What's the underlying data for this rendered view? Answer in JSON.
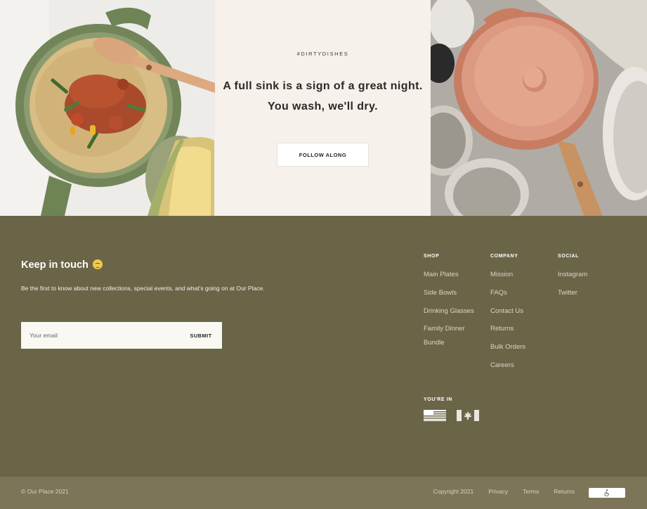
{
  "banner": {
    "hashtag": "#DIRTYDISHES",
    "headline_line1": "A full sink is a sign of a great night.",
    "headline_line2": "You wash, we'll dry.",
    "follow_label": "FOLLOW ALONG"
  },
  "newsletter": {
    "title": "Keep in touch",
    "subtitle": "Be the first to know about new collections, special events, and what's going on at Our Place.",
    "email_placeholder": "Your email",
    "submit_label": "SUBMIT"
  },
  "footer_nav": {
    "shop": {
      "heading": "SHOP",
      "links": [
        "Main Plates",
        "Side Bowls",
        "Drinking Glasses",
        "Family Dinner Bundle"
      ]
    },
    "company": {
      "heading": "COMPANY",
      "links": [
        "Mission",
        "FAQs",
        "Contact Us",
        "Returns",
        "Bulk Orders",
        "Careers"
      ]
    },
    "social": {
      "heading": "SOCIAL",
      "links": [
        "Instagram",
        "Twitter"
      ]
    }
  },
  "region": {
    "heading": "YOU'RE IN",
    "flags": [
      "us-flag-icon",
      "canada-flag-icon"
    ]
  },
  "bottom_bar": {
    "copyright": "© Our Place 2021",
    "copyright_right": "Copyright 2021",
    "privacy": "Privacy",
    "terms": "Terms",
    "returns": "Returns",
    "accessibility_icon": "accessibility-icon"
  },
  "colors": {
    "footer_bg": "#6b6548",
    "bottom_bar_bg": "#7c7558",
    "banner_mid_bg": "#f6f1ea",
    "pan_green": "#7a8a5e",
    "pot_terracotta": "#d99a80"
  }
}
